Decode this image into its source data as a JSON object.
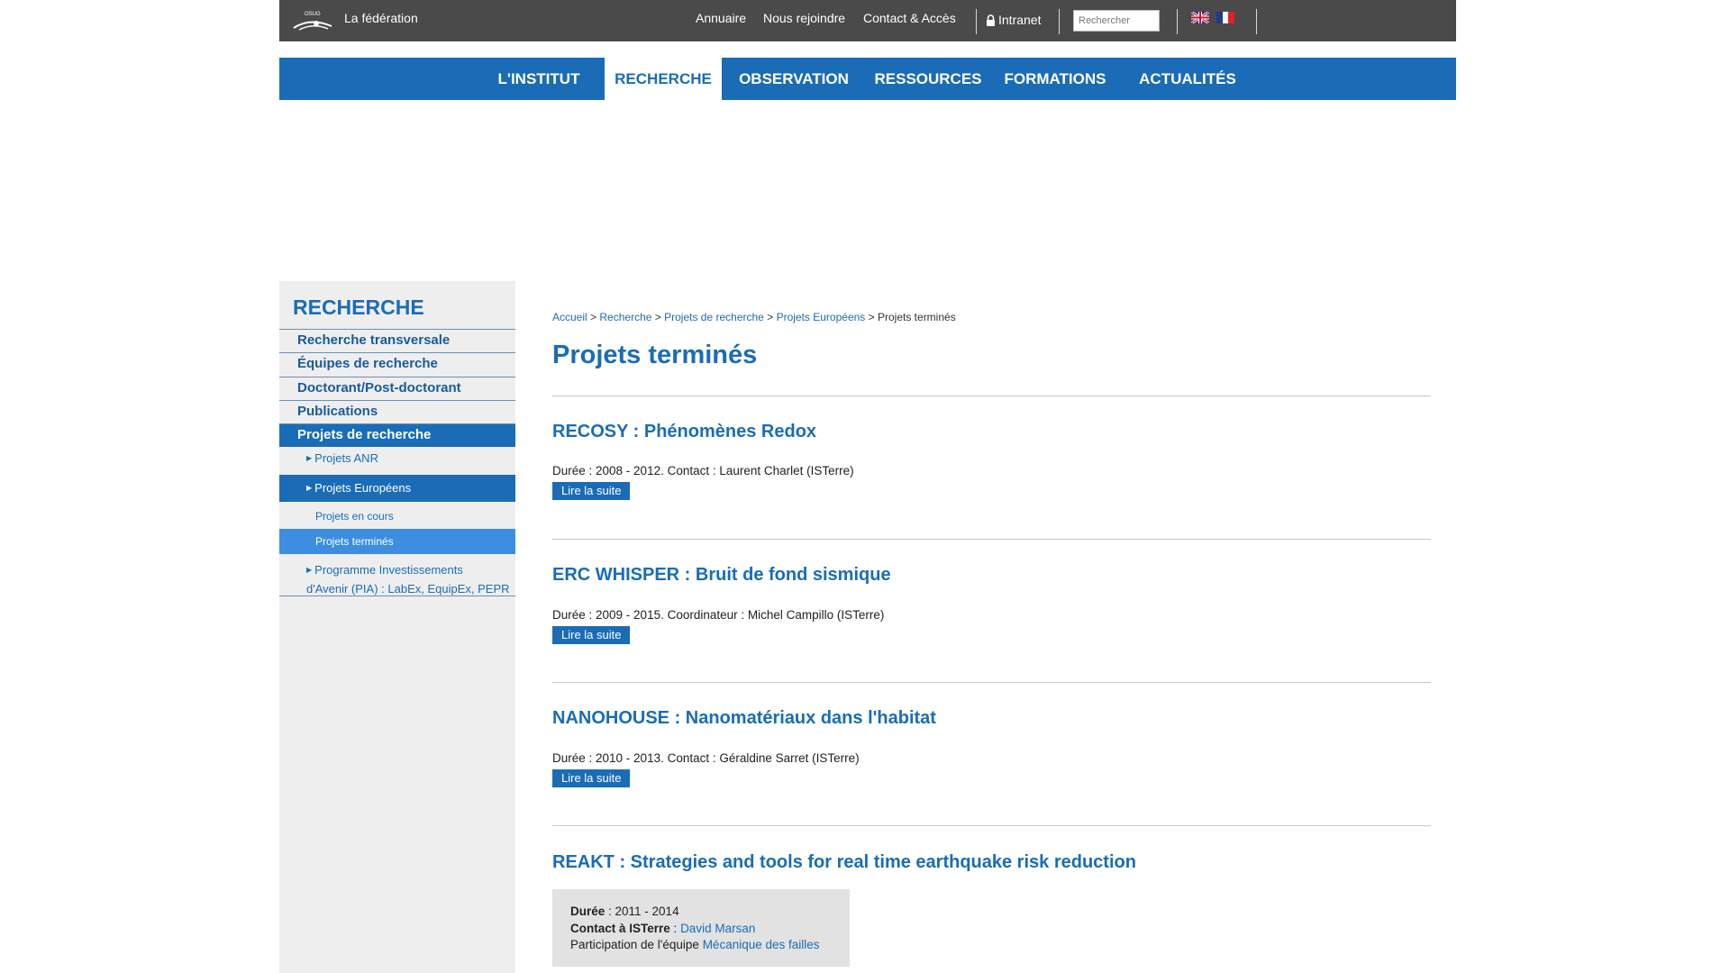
{
  "topbar": {
    "logo_text": "OSUG",
    "federation": "La fédération",
    "links": [
      "Annuaire",
      "Nous rejoindre",
      "Contact & Accès"
    ],
    "intranet": "Intranet",
    "search_placeholder": "Rechercher",
    "languages": [
      "English",
      "Français"
    ]
  },
  "nav": {
    "items": [
      "L'INSTITUT",
      "RECHERCHE",
      "OBSERVATION",
      "RESSOURCES",
      "FORMATIONS",
      "ACTUALITÉS"
    ],
    "active": "RECHERCHE"
  },
  "sidebar": {
    "title": "RECHERCHE",
    "items": [
      "Recherche transversale",
      "Équipes de recherche",
      "Doctorant/Post-doctorant",
      "Publications",
      "Projets de recherche"
    ],
    "sub_items": [
      "Projets ANR",
      "Projets Européens"
    ],
    "subsub_items": [
      "Projets en cours",
      "Projets terminés"
    ],
    "pia_line1": "Programme Investissements",
    "pia_line2": "d'Avenir (PIA) : LabEx, EquipEx, PEPR"
  },
  "breadcrumb": {
    "items": [
      "Accueil",
      "Recherche",
      "Projets de recherche",
      "Projets Européens"
    ],
    "current": "Projets terminés",
    "separator": ">"
  },
  "page_title": "Projets terminés",
  "read_more": "Lire la suite",
  "projects": [
    {
      "title": "RECOSY : Phénomènes Redox",
      "desc": "Durée : 2008 - 2012. Contact : Laurent Charlet (ISTerre)"
    },
    {
      "title": "ERC WHISPER : Bruit de fond sismique",
      "desc": "Durée : 2009 - 2015. Coordinateur : Michel Campillo (ISTerre)"
    },
    {
      "title": "NANOHOUSE : Nanomatériaux dans l'habitat",
      "desc": "Durée : 2010 - 2013. Contact : Géraldine Sarret (ISTerre)"
    },
    {
      "title": "REAKT : Strategies and tools for real time earthquake risk reduction"
    }
  ],
  "infobox": {
    "duree_label": "Durée",
    "duree_value": " : 2011 - 2014",
    "contact_label": "Contact à ISTerre",
    "contact_sep": " : ",
    "contact_value": "David Marsan",
    "participation_label": "Participation de l'équipe ",
    "participation_value": "Mécanique des failles"
  },
  "colors": {
    "primary": "#1a6cb7",
    "topbar": "#4a4a4a",
    "sidebar_bg": "#eeeeee",
    "highlight": "#3d8de0"
  }
}
